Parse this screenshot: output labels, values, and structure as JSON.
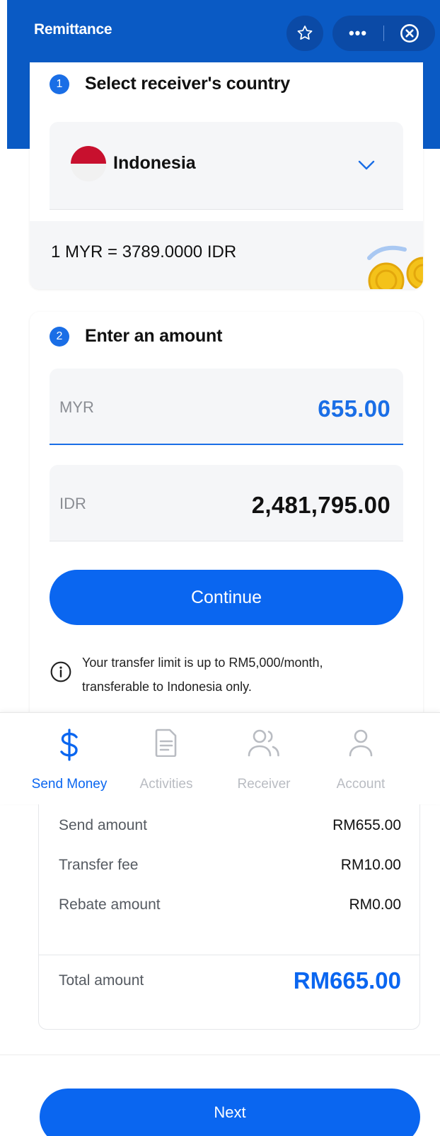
{
  "header": {
    "title": "Remittance",
    "more_label": "•••",
    "colors": {
      "primary": "#0a5ac4",
      "accent": "#0a66f0"
    }
  },
  "step1": {
    "number": "1",
    "title": "Select receiver's country",
    "country": "Indonesia",
    "flag_icon": "indonesia-flag-icon",
    "rate": "1 MYR = 3789.0000 IDR"
  },
  "step2": {
    "number": "2",
    "title": "Enter an amount",
    "send_currency": "MYR",
    "send_amount": "655.00",
    "receive_currency": "IDR",
    "receive_amount": "2,481,795.00",
    "continue_label": "Continue",
    "limit_text": "Your transfer limit is up to  RM5,000/month, transferable to  Indonesia  only."
  },
  "nav": {
    "items": [
      {
        "label": "Send Money",
        "icon": "dollar-icon",
        "active": true
      },
      {
        "label": "Activities",
        "icon": "document-icon",
        "active": false
      },
      {
        "label": "Receiver",
        "icon": "users-icon",
        "active": false
      },
      {
        "label": "Account",
        "icon": "user-icon",
        "active": false
      }
    ]
  },
  "summary": {
    "send_label": "Send amount",
    "send_value": "RM655.00",
    "fee_label": "Transfer fee",
    "fee_value": "RM10.00",
    "rebate_label": "Rebate amount",
    "rebate_value": "RM0.00",
    "total_label": "Total amount",
    "total_value": "RM665.00"
  },
  "next_label": "Next"
}
